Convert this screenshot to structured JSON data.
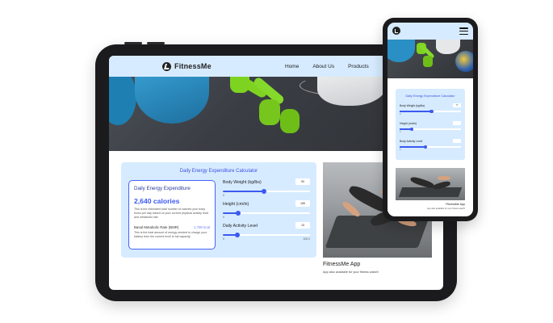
{
  "brand": {
    "name": "FitnessMe"
  },
  "nav": {
    "links": [
      "Home",
      "About Us",
      "Products",
      "Co"
    ]
  },
  "calculator": {
    "title": "Daily Energy Expenditure Calculator",
    "result": {
      "heading": "Daily Energy Expenditure",
      "calories": "2,640 calories",
      "description": "This is the estimated total number of calories your body burns per day based on your current physical activity level and metabolic rate.",
      "bmr_label": "Basal Metabolic Rate (BMR)",
      "bmr_value": "1,780 kcal",
      "bmr_description": "This is the total amount of energy needed to charge your battery from the current level to full capacity."
    },
    "sliders": [
      {
        "label": "Body Weight (kg/lbs)",
        "value": "50",
        "min": "0",
        "max": "",
        "fraction": 0.47
      },
      {
        "label": "Height (cm/in)",
        "value": "185",
        "min": "0",
        "max": "",
        "fraction": 0.18
      },
      {
        "label": "Daily Activity Level",
        "value": "15",
        "min": "0",
        "max": "100.0",
        "fraction": 0.17
      }
    ]
  },
  "app": {
    "title": "FitnessMe App",
    "subtitle": "App also available for your fitness watch!"
  },
  "phone": {
    "calculator_title": "Daily Energy Expenditure Calculator",
    "sliders": [
      {
        "label": "Body Weight (kg/lbs)",
        "value": "77",
        "min": "0",
        "max": "",
        "fraction": 0.52
      },
      {
        "label": "Height (cm/in)",
        "value": "",
        "min": "0",
        "max": "",
        "fraction": 0.2
      },
      {
        "label": "Body Activity Level",
        "value": "",
        "min": "0",
        "max": "",
        "fraction": 0.42
      }
    ],
    "app_title": "FitnessMe App",
    "app_subtitle": "App also available for your fitness watch!"
  },
  "icons": {
    "logo": "runner-icon",
    "menu": "hamburger-menu-icon"
  },
  "colors": {
    "accent": "#3c59f0",
    "panel": "#d6ebff",
    "device": "#1b1b1d"
  }
}
